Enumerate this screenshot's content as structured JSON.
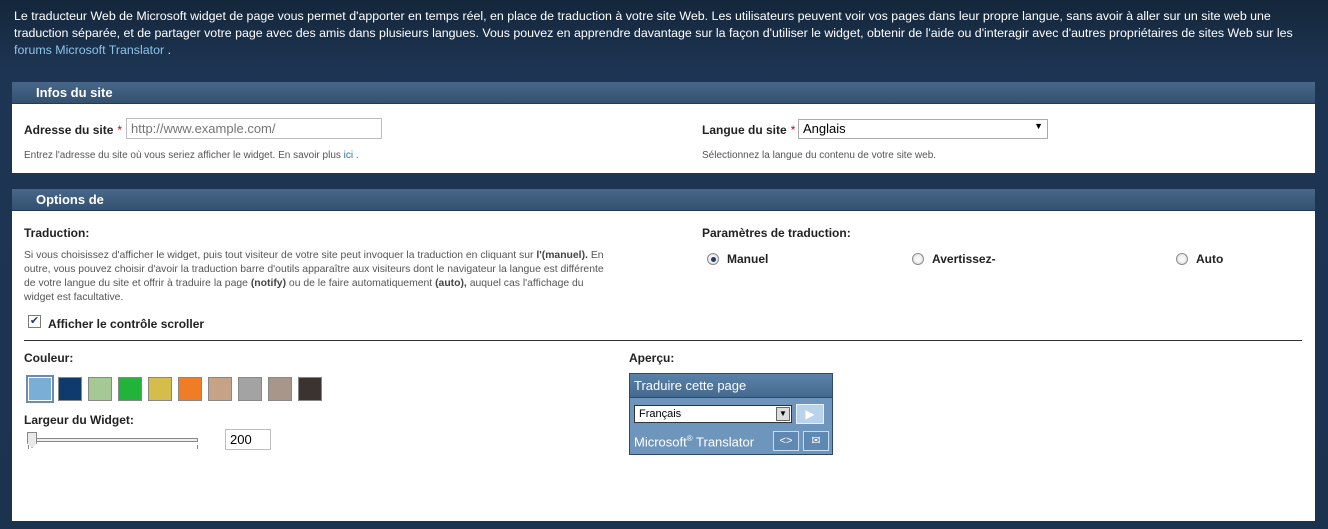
{
  "intro": {
    "text_before_link": "Le traducteur Web de Microsoft widget de page vous permet d'apporter en temps réel, en place de traduction à votre site Web. Les utilisateurs peuvent voir vos pages dans leur propre langue, sans avoir à aller sur un site web une traduction séparée, et de partager votre page avec des amis dans plusieurs langues. Vous pouvez en apprendre davantage sur la façon d'utiliser le widget, obtenir de l'aide ou d'interagir avec d'autres propriétaires de sites Web sur les",
    "link_text": "forums Microsoft Translator",
    "text_after_link": "."
  },
  "site_panel": {
    "title": "Infos du site",
    "address_label": "Adresse du site",
    "required_mark": "*",
    "address_placeholder": "http://www.example.com/",
    "address_hint": "Entrez l'adresse du site où vous seriez afficher le widget. En savoir plus",
    "address_hint_link": "ici",
    "address_hint_end": ".",
    "language_label": "Langue du site",
    "language_value": "Anglais",
    "language_hint": "Sélectionnez la langue du contenu de votre site web."
  },
  "options_panel": {
    "title": "Options de",
    "translation_label": "Traduction:",
    "translation_desc_1": "Si vous choisissez d'afficher le widget, puis tout visiteur de votre site peut invoquer la traduction en cliquant sur",
    "translation_desc_bold_1": "l'(manuel).",
    "translation_desc_2": "En outre, vous pouvez choisir d'avoir la traduction barre d'outils apparaître aux visiteurs dont le navigateur la langue est différente de votre langue du site et offrir à traduire la page",
    "translation_desc_bold_2": "(notify)",
    "translation_desc_3": "ou de le faire automatiquement",
    "translation_desc_bold_3": "(auto),",
    "translation_desc_4": "auquel cas l'affichage du widget est facultative.",
    "settings_label": "Paramètres de traduction:",
    "radio_manual": "Manuel",
    "radio_notify": "Avertissez-",
    "radio_auto": "Auto",
    "scroller_label": "Afficher le contrôle scroller",
    "color_label": "Couleur:",
    "colors": [
      "#7aaed6",
      "#0f3a6e",
      "#a6c895",
      "#22b33a",
      "#d4bd4a",
      "#f07c26",
      "#c6a386",
      "#a3a3a3",
      "#a8968a",
      "#3b3330"
    ],
    "width_label": "Largeur du Widget:",
    "width_value": "200",
    "width_fraction": 0.0,
    "preview_label": "Aperçu:",
    "preview_title": "Traduire cette page",
    "preview_language": "Français",
    "preview_brand": "Microsoft",
    "preview_brand_mark": "®",
    "preview_brand_2": "Translator"
  }
}
